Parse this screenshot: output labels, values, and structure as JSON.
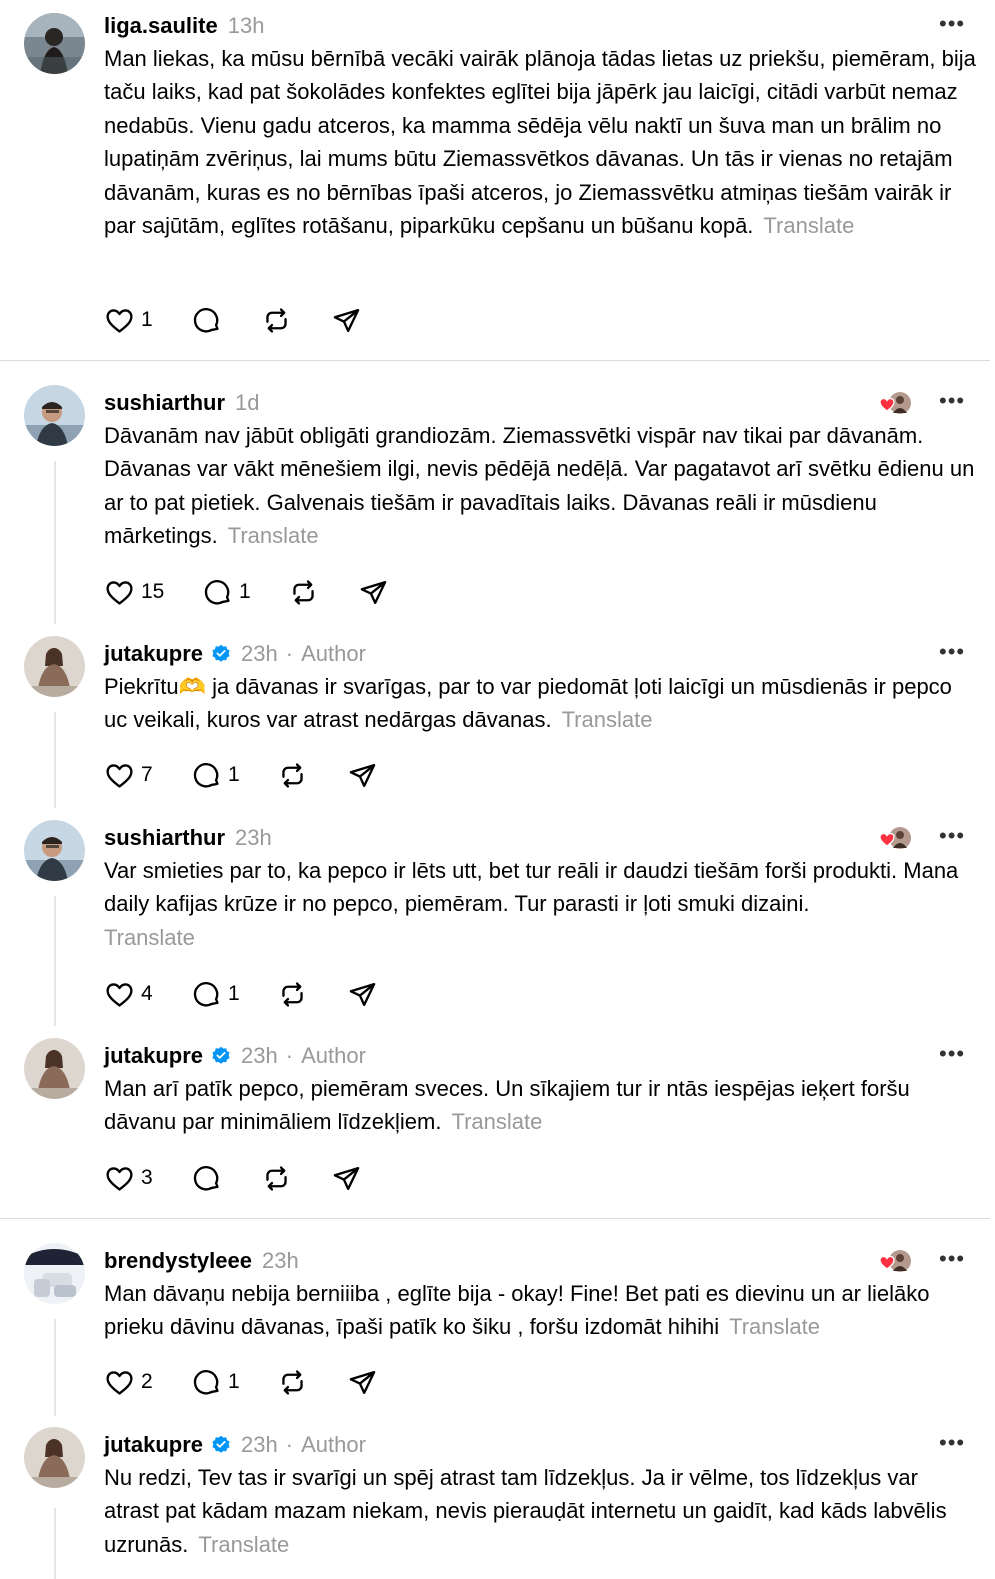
{
  "translate_label": "Translate",
  "more_glyph": "•••",
  "author_label": "Author",
  "accent_verified": "#0095f6",
  "like_heart_color": "#ff3040",
  "posts": [
    {
      "username": "liga.saulite",
      "time": "13h",
      "verified": false,
      "is_author": false,
      "text": "Man liekas, ka mūsu bērnībā vecāki vairāk plānoja tādas lietas uz priekšu, piemēram, bija taču laiks, kad pat šokolādes konfektes eglītei bija jāpērk jau laicīgi, citādi varbūt nemaz nedabūs. Vienu gadu atceros, ka mamma sēdēja vēlu naktī un šuva man un brālim no lupatiņām zvēriņus, lai mums būtu Ziemassvētkos dāvanas. Un tās ir vienas no retajām dāvanām, kuras es no bērnības īpaši atceros, jo Ziemassvētku atmiņas tiešām vairāk ir par sajūtām, eglītes rotāšanu, piparkūku cepšanu un būšanu kopā.",
      "likes": "1",
      "replies": "",
      "liked_by_author": false
    },
    {
      "username": "sushiarthur",
      "time": "1d",
      "verified": false,
      "is_author": false,
      "text": "Dāvanām nav jābūt obligāti grandiozām. Ziemassvētki vispār nav tikai par dāvanām. Dāvanas var vākt mēnešiem ilgi, nevis pēdējā nedēļā. Var pagatavot arī svētku ēdienu un ar to pat pietiek. Galvenais tiešām ir pavadītais laiks. Dāvanas reāli ir mūsdienu mārketings.",
      "likes": "15",
      "replies": "1",
      "liked_by_author": true
    },
    {
      "username": "jutakupre",
      "time": "23h",
      "verified": true,
      "is_author": true,
      "text": "Piekrītu🫶 ja dāvanas ir svarīgas, par to var piedomāt ļoti laicīgi un mūsdienās ir pepco uc veikali, kuros var atrast nedārgas dāvanas.",
      "likes": "7",
      "replies": "1",
      "liked_by_author": false
    },
    {
      "username": "sushiarthur",
      "time": "23h",
      "verified": false,
      "is_author": false,
      "text": "Var smieties par to, ka pepco ir lēts utt, bet tur reāli ir daudzi tiešām forši produkti. Mana daily kafijas krūze ir no pepco, piemēram. Tur parasti ir ļoti smuki dizaini.",
      "likes": "4",
      "replies": "1",
      "liked_by_author": true
    },
    {
      "username": "jutakupre",
      "time": "23h",
      "verified": true,
      "is_author": true,
      "text": "Man arī patīk pepco, piemēram sveces. Un sīkajiem tur ir ntās iespējas ieķert foršu dāvanu par minimāliem līdzekļiem.",
      "likes": "3",
      "replies": "",
      "liked_by_author": false
    },
    {
      "username": "brendystyleee",
      "time": "23h",
      "verified": false,
      "is_author": false,
      "text": "Man dāvaņu nebija berniiiba , eglīte bija - okay! Fine! Bet pati es dievinu un ar lielāko prieku dāvinu dāvanas, īpaši patīk ko šiku , foršu izdomāt hihihi",
      "likes": "2",
      "replies": "1",
      "liked_by_author": true
    },
    {
      "username": "jutakupre",
      "time": "23h",
      "verified": true,
      "is_author": true,
      "text": "Nu redzi, Tev tas ir svarīgi un spēj atrast tam līdzekļus. Ja ir vēlme, tos līdzekļus var atrast pat kādam mazam niekam, nevis pierauḍāt internetu un gaidīt, kad kāds labvēlis uzrunās.",
      "likes": "",
      "replies": "",
      "liked_by_author": false
    }
  ]
}
